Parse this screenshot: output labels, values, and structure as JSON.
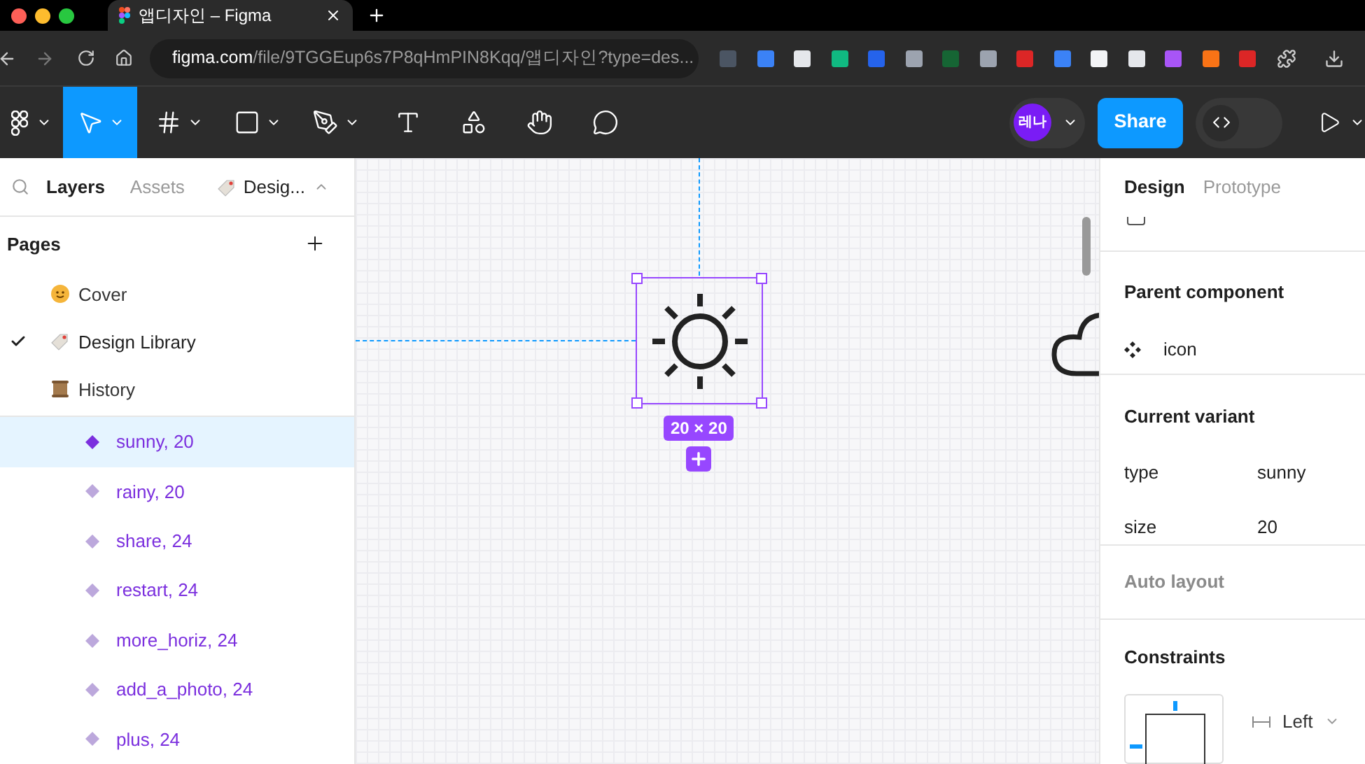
{
  "browser": {
    "tab_title": "앱디자인 – Figma",
    "url_host": "figma.com",
    "url_path": "/file/9TGGEup6s7P8qHmPIN8Kqq/앱디자인?type=des..."
  },
  "toolbar": {
    "tools": [
      {
        "kind": "move",
        "selected": true
      },
      {
        "kind": "frame",
        "selected": false
      },
      {
        "kind": "shape",
        "selected": false
      },
      {
        "kind": "pen",
        "selected": false
      },
      {
        "kind": "text",
        "selected": false
      },
      {
        "kind": "resources",
        "selected": false
      },
      {
        "kind": "hand",
        "selected": false
      },
      {
        "kind": "comment",
        "selected": false
      }
    ],
    "avatar": "레나",
    "share": "Share",
    "dev_mode": {
      "on": false
    }
  },
  "left_panel": {
    "tabs": [
      {
        "label": "Layers",
        "selected": true
      },
      {
        "label": "Assets",
        "selected": false
      }
    ],
    "page_menu": "Desig...",
    "pages_title": "Pages",
    "pages": [
      {
        "kind": "face",
        "label": "Cover",
        "selected": false
      },
      {
        "kind": "tag",
        "label": "Design Library",
        "selected": true
      },
      {
        "kind": "scroll",
        "label": "History",
        "selected": false
      }
    ],
    "layers": [
      {
        "label": "sunny, 20",
        "selected": true
      },
      {
        "label": "rainy, 20",
        "selected": false
      },
      {
        "label": "share, 24",
        "selected": false
      },
      {
        "label": "restart, 24",
        "selected": false
      },
      {
        "label": "more_horiz, 24",
        "selected": false
      },
      {
        "label": "add_a_photo, 24",
        "selected": false
      },
      {
        "label": "plus, 24",
        "selected": false
      }
    ]
  },
  "canvas": {
    "size_label": "20 × 20"
  },
  "right_panel": {
    "tabs": [
      {
        "label": "Design",
        "selected": true
      },
      {
        "label": "Prototype",
        "selected": false
      }
    ],
    "clip_content": {
      "checked": false
    },
    "parent_component": {
      "title": "Parent component",
      "name": "icon"
    },
    "current_variant": {
      "title": "Current variant",
      "properties": [
        {
          "name": "type",
          "value": "sunny"
        },
        {
          "name": "size",
          "value": "20"
        }
      ]
    },
    "auto_layout": {
      "title": "Auto layout"
    },
    "constraints": {
      "title": "Constraints",
      "horizontal": "Left"
    }
  }
}
